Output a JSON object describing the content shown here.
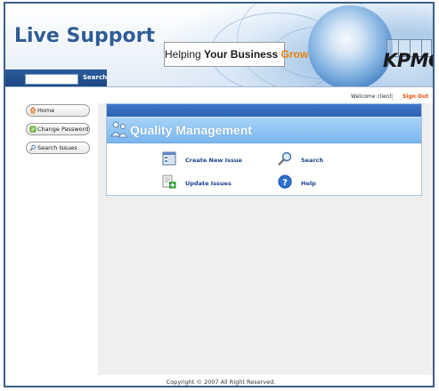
{
  "header": {
    "logo_text": "Live Support",
    "tagline_part1": "Helping ",
    "tagline_part2": "Your Business ",
    "tagline_part3": "Grow",
    "brand": "KPMG",
    "search": {
      "placeholder": "",
      "value": "",
      "button_label": "Search"
    }
  },
  "user_bar": {
    "welcome_text": "Welcome client",
    "sign_out_label": "Sign Out"
  },
  "sidebar": {
    "items": [
      {
        "label": "Home",
        "icon": "home-icon"
      },
      {
        "label": "Change Password",
        "icon": "key-icon"
      },
      {
        "label": "Search Issues",
        "icon": "search-icon"
      }
    ]
  },
  "panel": {
    "title": "Quality Management",
    "actions": [
      {
        "label": "Create New Issue",
        "icon": "form-icon"
      },
      {
        "label": "Search",
        "icon": "magnifier-icon"
      },
      {
        "label": "Update Issues",
        "icon": "add-document-icon"
      },
      {
        "label": "Help",
        "icon": "help-icon"
      }
    ]
  },
  "footer": {
    "copyright": "Copyright © 2007 All Right Reserved."
  },
  "colors": {
    "brand_blue": "#2e5c96",
    "accent_orange": "#e8820c",
    "sign_out": "#e8500c",
    "panel_header": "#7ab7ef",
    "link": "#1f3f8f"
  }
}
